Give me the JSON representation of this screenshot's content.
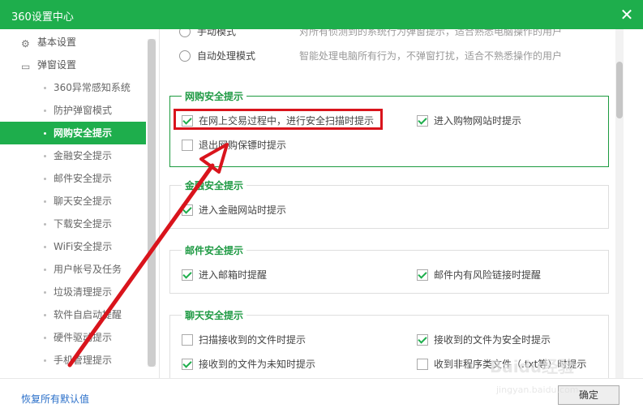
{
  "window": {
    "title": "360设置中心"
  },
  "sidebar": {
    "groups": [
      {
        "label": "基本设置",
        "icon": "gear-icon"
      },
      {
        "label": "弹窗设置",
        "icon": "window-icon"
      }
    ],
    "items": [
      {
        "label": "360异常感知系统"
      },
      {
        "label": "防护弹窗模式"
      },
      {
        "label": "网购安全提示",
        "active": true
      },
      {
        "label": "金融安全提示"
      },
      {
        "label": "邮件安全提示"
      },
      {
        "label": "聊天安全提示"
      },
      {
        "label": "下载安全提示"
      },
      {
        "label": "WiFi安全提示"
      },
      {
        "label": "用户帐号及任务"
      },
      {
        "label": "垃圾清理提示"
      },
      {
        "label": "软件自启动提醒"
      },
      {
        "label": "硬件驱动提示"
      },
      {
        "label": "手机管理提示"
      }
    ]
  },
  "mode": {
    "manual_label": "手动模式",
    "manual_desc": "对所有侦测到的系统行为弹窗提示，适合熟悉电脑操作的用户",
    "auto_label": "自动处理模式",
    "auto_desc": "智能处理电脑所有行为，不弹窗打扰，适合不熟悉操作的用户"
  },
  "shopping": {
    "title": "网购安全提示",
    "options": [
      {
        "label": "在网上交易过程中，进行安全扫描时提示",
        "checked": true
      },
      {
        "label": "进入购物网站时提示",
        "checked": true
      },
      {
        "label": "退出网购保镖时提示",
        "checked": false
      }
    ]
  },
  "finance": {
    "title": "金融安全提示",
    "options": [
      {
        "label": "进入金融网站时提示",
        "checked": true
      }
    ]
  },
  "mail": {
    "title": "邮件安全提示",
    "options": [
      {
        "label": "进入邮箱时提醒",
        "checked": true
      },
      {
        "label": "邮件内有风险链接时提醒",
        "checked": true
      }
    ]
  },
  "chat": {
    "title": "聊天安全提示",
    "options": [
      {
        "label": "扫描接收到的文件时提示",
        "checked": false
      },
      {
        "label": "接收到的文件为安全时提示",
        "checked": true
      },
      {
        "label": "接收到的文件为未知时提示",
        "checked": true
      },
      {
        "label": "收到非程序类文件（.txt等）时提示",
        "checked": false
      }
    ]
  },
  "footer": {
    "restore_label": "恢复所有默认值",
    "ok_label": "确定"
  },
  "watermark": {
    "line1": "Baidu经验",
    "line2": "jingyan.baidu.com"
  },
  "colors": {
    "accent": "#1eae4c",
    "annotation": "#d9141c"
  }
}
